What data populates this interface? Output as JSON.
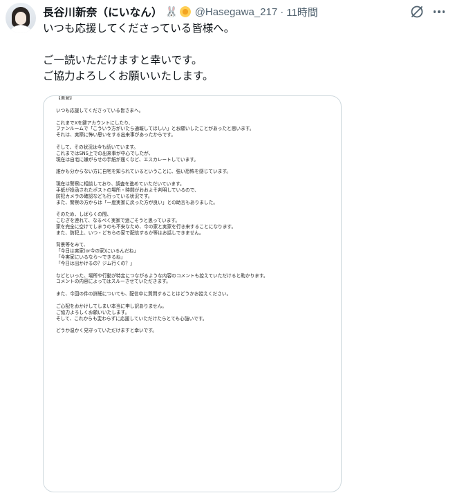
{
  "user": {
    "display_name": "長谷川新奈（にいなん）",
    "emojis": [
      "rabbit-icon",
      "flower-icon"
    ],
    "handle": "@Hasegawa_217",
    "separator": "·",
    "time": "11時間"
  },
  "tweet": {
    "paragraphs": [
      [
        "いつも応援してくださっている皆様へ。"
      ],
      [
        "ご一読いただけますと幸いです。",
        "ご協力よろしくお願いいたします。"
      ]
    ]
  },
  "document": {
    "header": "【重要】",
    "blocks": [
      [
        "いつも応援してくださっている皆さまへ。"
      ],
      [
        "これまでXを鍵アカウントにしたり、",
        "ファンルームで「こういう方がいたら通報してほしい」とお願いしたことがあったと思います。",
        "それは、実際に怖い思いをする出来事があったからです。"
      ],
      [
        "そして、その状況は今も続いています。",
        "これまではSNS上での出来事が中心でしたが、",
        "現在は自宅に嫌がらせの手紙が届くなど、エスカレートしています。"
      ],
      [
        "誰かも分からない方に自宅を知られているということに、強い恐怖を感じています。"
      ],
      [
        "現在は警察に相談しており、調査を進めていただいています。",
        "手紙が投函されたポストの場所・時間がおおよそ判明しているので、",
        "防犯カメラの確認なども行っている状況です。",
        "また、警察の方からは「一度実家に戻った方が良い」との助言もありました。"
      ],
      [
        "そのため、しばらくの間、",
        "こむぎを連れて、なるべく実家で過ごそうと思っています。",
        "家を完全に空けてしまうのも不安なため、今の家と実家を行き来することになります。",
        "また、防犯上、いつ・どちらの家で配信するか等はお話しできません。"
      ],
      [
        "背景等をみて、",
        "「今日は実家(or今の家)にいるんだね」",
        "「今実家にいるなら～できるね」",
        "「今日は出かけるの？ジム行くの？」"
      ],
      [
        "などといった、場所や行動が特定につながるような内容のコメントも控えていただけると助かります。",
        "コメントの内容によってはスルーさせていただきます。"
      ],
      [
        "また、今回の件の詳細についても、配信中に質問することはどうかお控えください。"
      ],
      [
        "ご心配をおかけしてしまい本当に申し訳ありません。",
        "ご協力よろしくお願いいたします。",
        "そして、これからも変わらずに応援していただけたらとても心強いです。"
      ],
      [
        "どうか温かく見守っていただけますと幸いです。"
      ]
    ]
  },
  "icons": {
    "grok": "grok-icon",
    "more": "more-icon"
  },
  "colors": {
    "text": "#0f1419",
    "secondary": "#536471",
    "border": "#cfd9de"
  }
}
